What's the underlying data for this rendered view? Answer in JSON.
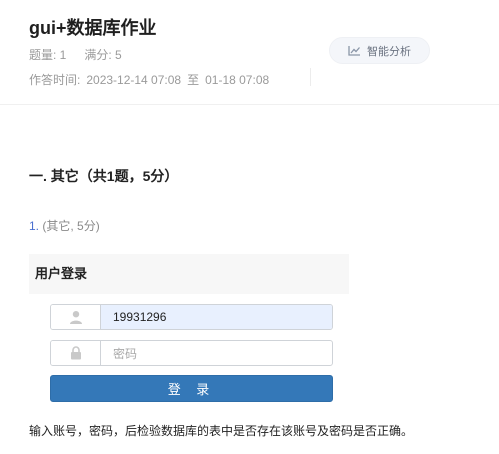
{
  "header": {
    "title": "gui+数据库作业",
    "count_label": "题量: 1",
    "score_label": "满分: 5",
    "time_label": "作答时间:",
    "time_start": "2023-12-14 07:08",
    "time_sep": "至",
    "time_end": "01-18 07:08",
    "ai_button_label": "智能分析"
  },
  "section": {
    "heading": "一. 其它（共1题，5分）"
  },
  "question": {
    "number": "1.",
    "meta": "(其它, 5分)",
    "login_form": {
      "title": "用户登录",
      "username_value": "19931296",
      "password_placeholder": "密码",
      "login_button_label": "登 录"
    },
    "description": "输入账号，密码，后检验数据库的表中是否存在该账号及密码是否正确。"
  },
  "colors": {
    "login_button": "#3478b8",
    "username_fill": "#e8f0fe",
    "accent_number": "#4a6fd0"
  },
  "icons": {
    "ai_button": "chart-line-icon",
    "username": "user-icon",
    "password": "lock-icon"
  }
}
